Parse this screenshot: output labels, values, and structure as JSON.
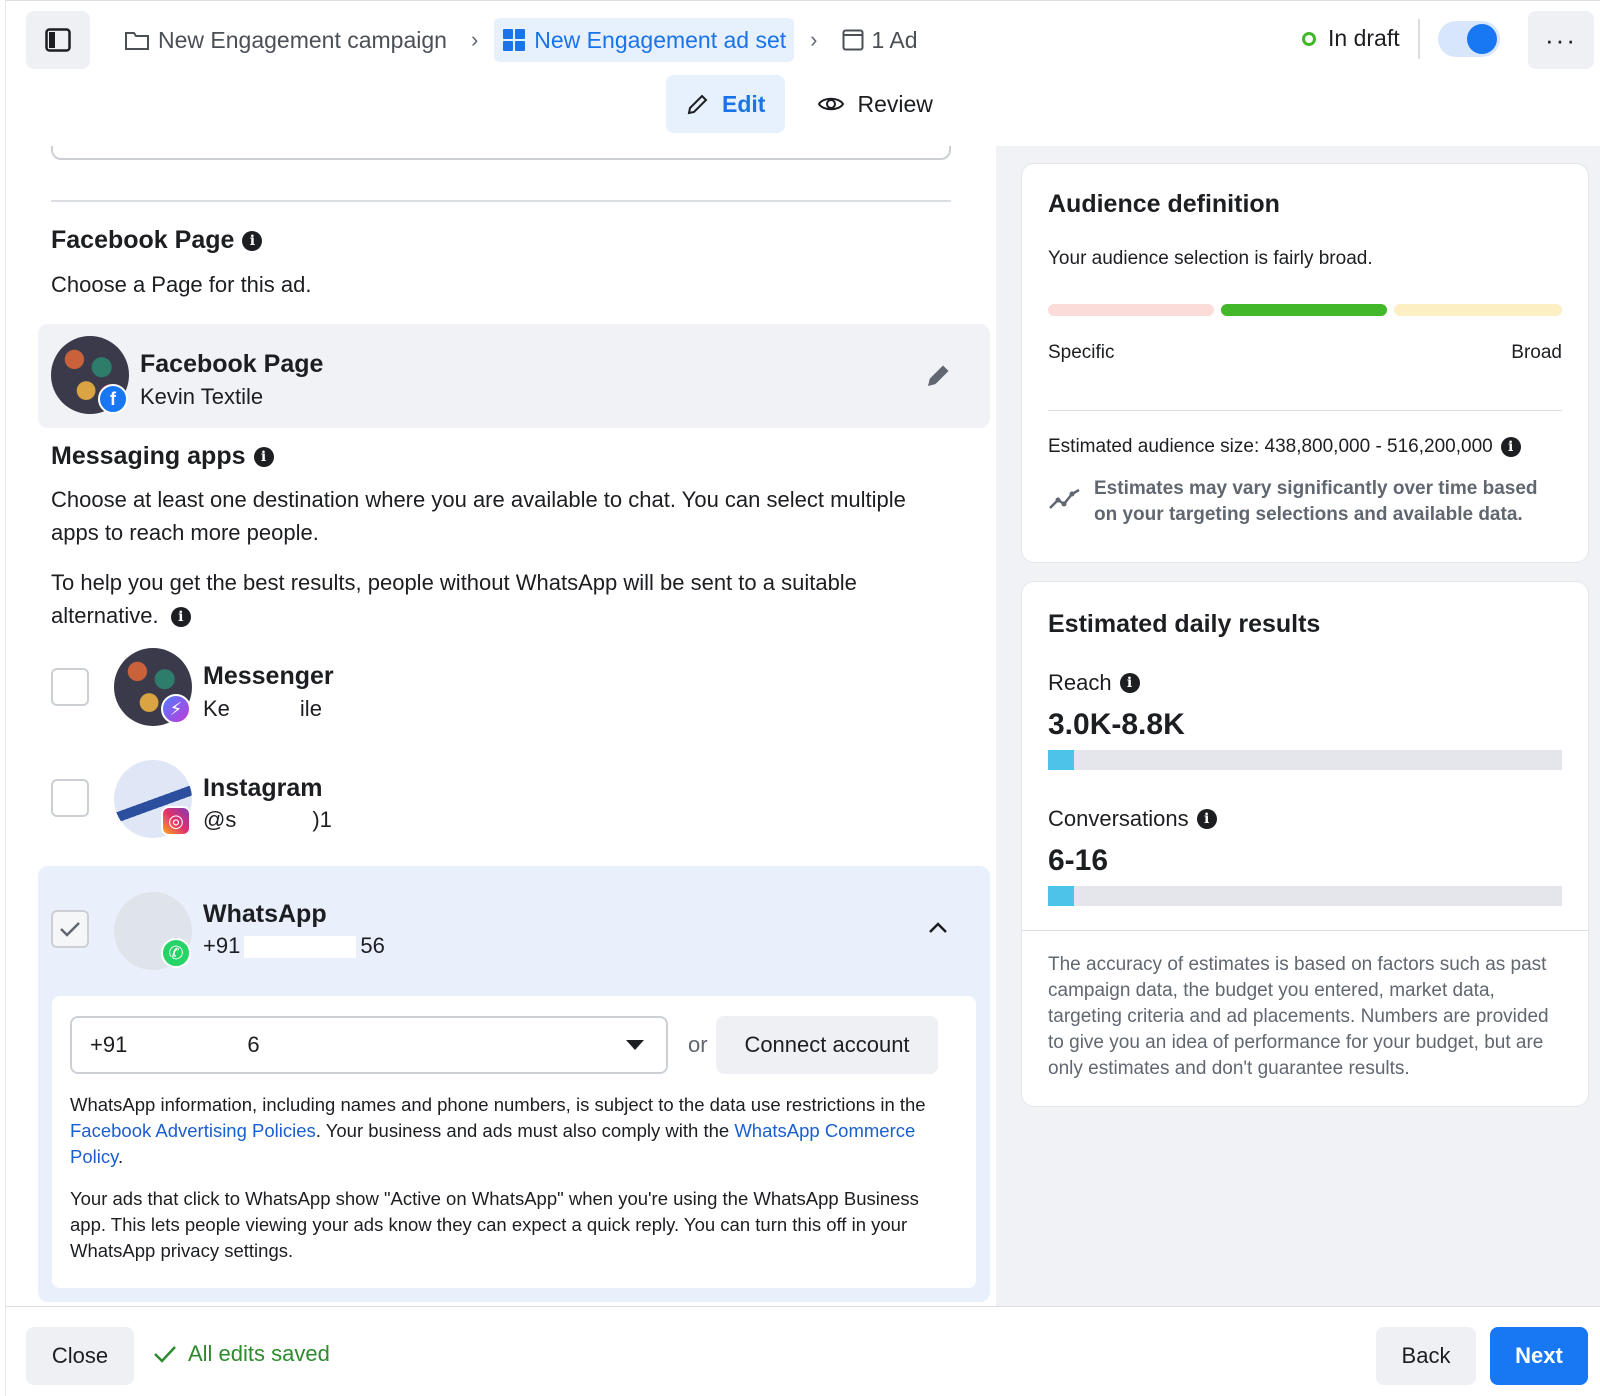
{
  "header": {
    "breadcrumbs": [
      {
        "label": "New Engagement campaign"
      },
      {
        "label": "New Engagement ad set"
      },
      {
        "label": "1 Ad"
      }
    ],
    "status": "In draft",
    "more_label": "···",
    "tabs": [
      {
        "label": "Edit"
      },
      {
        "label": "Review"
      }
    ]
  },
  "facebook_page": {
    "title": "Facebook Page",
    "subtitle": "Choose a Page for this ad.",
    "selected": {
      "name": "Facebook Page",
      "account": "Kevin Textile"
    }
  },
  "messaging": {
    "title": "Messaging apps",
    "description": "Choose at least one destination where you are available to chat. You can select multiple apps to reach more people.",
    "help_text": "To help you get the best results, people without WhatsApp will be sent to a suitable alternative.",
    "apps": [
      {
        "name": "Messenger",
        "account": "Ke",
        "account_tail": "ile",
        "checked": false
      },
      {
        "name": "Instagram",
        "account": "@s",
        "account_tail": ")1",
        "checked": false
      },
      {
        "name": "WhatsApp",
        "account": "+91",
        "account_tail": "56",
        "checked": true
      }
    ],
    "whatsapp": {
      "phone_value": "+91",
      "phone_tail": "6",
      "or_label": "or",
      "connect_label": "Connect account",
      "policy_pre": "WhatsApp information, including names and phone numbers, is subject to the data use restrictions in the ",
      "policy_link1": "Facebook Advertising Policies",
      "policy_mid": ". Your business and ads must also comply with the ",
      "policy_link2": "WhatsApp Commerce Policy",
      "policy_end": ".",
      "active_note": "Your ads that click to WhatsApp show \"Active on WhatsApp\" when you're using the WhatsApp Business app. This lets people viewing your ads know they can expect a quick reply. You can turn this off in your WhatsApp privacy settings."
    }
  },
  "audience": {
    "title": "Audience definition",
    "summary": "Your audience selection is fairly broad.",
    "meter": {
      "left_label": "Specific",
      "right_label": "Broad",
      "level": "middle"
    },
    "size_label": "Estimated audience size: 438,800,000 - 516,200,000",
    "note": "Estimates may vary significantly over time based on your targeting selections and available data."
  },
  "daily_results": {
    "title": "Estimated daily results",
    "reach_label": "Reach",
    "reach_value": "3.0K-8.8K",
    "reach_fill": 0.05,
    "conv_label": "Conversations",
    "conv_value": "6-16",
    "conv_fill": 0.05,
    "disclaimer": "The accuracy of estimates is based on factors such as past campaign data, the budget you entered, market data, targeting criteria and ad placements. Numbers are provided to give you an idea of performance for your budget, but are only estimates and don't guarantee results."
  },
  "footer": {
    "close_label": "Close",
    "saved_label": "All edits saved",
    "back_label": "Back",
    "next_label": "Next"
  },
  "colors": {
    "accent": "#1877f2",
    "meter_specific": "#fbdcd8",
    "meter_mid": "#42b72a",
    "meter_broad": "#fcefc4",
    "estimate_bar": "#4dc3ea"
  }
}
